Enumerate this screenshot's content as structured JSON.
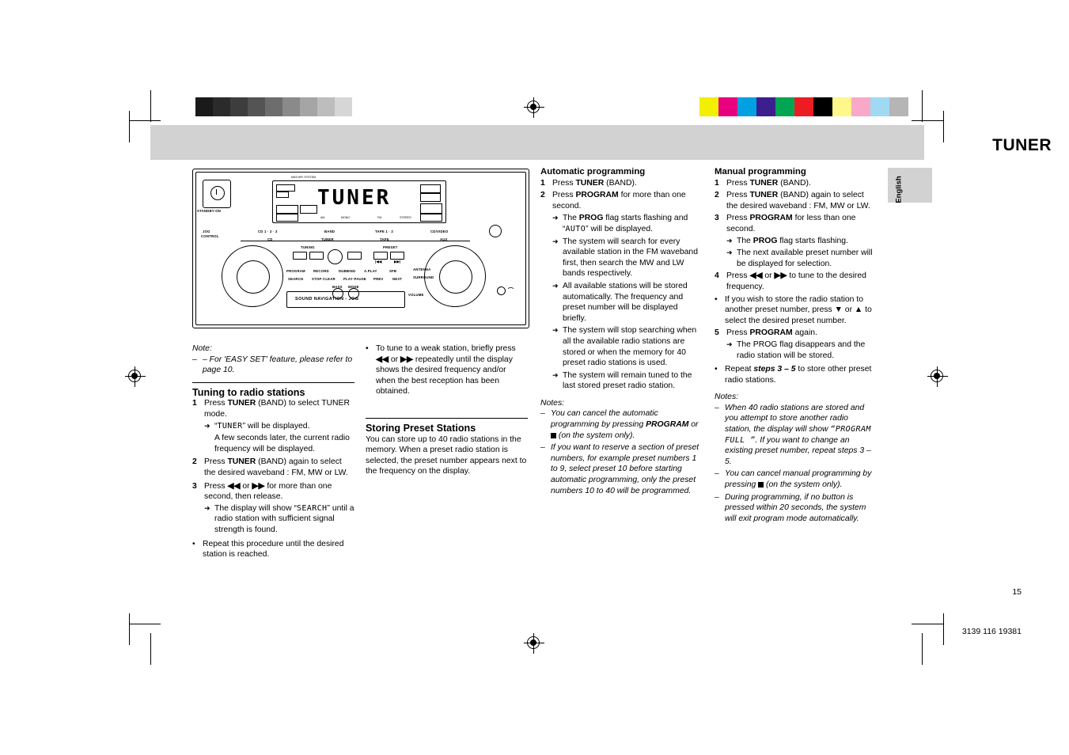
{
  "header": {
    "title": "TUNER",
    "side_tab": "English"
  },
  "device": {
    "brand": "MINI HIFI SYSTEM",
    "display_text": "TUNER",
    "standby_label": "STANDBY-ON",
    "jog_label": "JOG",
    "jog_label2": "CONTROL",
    "source_labels": [
      "CD 1 · 2 · 3",
      "BAND",
      "TAPE 1 · 2",
      "CD/VIDEO"
    ],
    "source_labels2": [
      "CD",
      "TUNER",
      "TAPE",
      "AUX"
    ],
    "tuning_label": "TUNING",
    "preset_label": "PRESET",
    "button_row": [
      "PROGRAM",
      "RECORD",
      "DUBBING",
      "A.PLAY",
      "SFB",
      "ANTENNA"
    ],
    "button_row2": [
      "SEARCH",
      "STOP-CLEAR",
      "PLAY-PAUSE",
      "PREV",
      "NEXT"
    ],
    "nav_label": "SOUND NAVIGATION - JOG",
    "volume_label": "VOLUME",
    "headphone_label": "p"
  },
  "col1": {
    "note_title": "Note:",
    "note_items": [
      "– For 'EASY SET' feature, please refer to page 10."
    ],
    "heading": "Tuning to radio stations",
    "steps": [
      {
        "n": "1",
        "text_pre": "Press ",
        "bold": "TUNER",
        "text_post": " (BAND) to select TUNER mode.",
        "subs": [
          {
            "mark": "→",
            "parts": [
              {
                "t": "“"
              },
              {
                "t": "TUNER",
                "lcd": true
              },
              {
                "t": "” will be displayed."
              }
            ]
          },
          {
            "mark": "",
            "parts": [
              {
                "t": "A few seconds later, the current radio frequency will be displayed."
              }
            ]
          }
        ]
      },
      {
        "n": "2",
        "text_pre": "Press ",
        "bold": "TUNER",
        "text_post": " (BAND) again to select the desired waveband : FM, MW or LW.",
        "subs": []
      },
      {
        "n": "3",
        "text_pre": "Press ◂◂ or ▸▸ for more than one second, then release.",
        "bold": "",
        "text_post": "",
        "subs": [
          {
            "mark": "→",
            "parts": [
              {
                "t": "The display will show "
              },
              {
                "t": "“SEARCH”",
                "lcd": true
              },
              {
                "t": " until a radio station with sufficient signal strength is found."
              }
            ]
          }
        ]
      }
    ],
    "bullets": [
      "Repeat this procedure until the desired station is reached."
    ]
  },
  "col2": {
    "bullets_top": [
      "To tune to a weak station, briefly press ◂◂ or ▸▸ repeatedly until the display shows the desired frequency and/or when the best reception has been obtained."
    ],
    "heading": "Storing Preset Stations",
    "body": "You can store up to 40 radio stations in the memory. When a preset radio station is selected, the preset number appears next to the frequency on the display."
  },
  "col3": {
    "heading": "Automatic programming",
    "steps": [
      {
        "n": "1",
        "text_pre": "Press ",
        "bold": "TUNER",
        "text_post": " (BAND).",
        "subs": []
      },
      {
        "n": "2",
        "text_pre": "Press ",
        "bold": "PROGRAM",
        "text_post": " for more than one second.",
        "subs": [
          {
            "mark": "→",
            "parts": [
              {
                "t": "The "
              },
              {
                "t": "PROG",
                "bold": true
              },
              {
                "t": " flag starts flashing and "
              },
              {
                "t": "“AUTO”",
                "lcd": true
              },
              {
                "t": " will be displayed."
              }
            ]
          },
          {
            "mark": "→",
            "parts": [
              {
                "t": "The system will search for every available station in the FM waveband first, then search the MW and LW bands respectively."
              }
            ]
          },
          {
            "mark": "→",
            "parts": [
              {
                "t": "All available stations will be stored automatically. The frequency and preset number will be displayed briefly."
              }
            ]
          },
          {
            "mark": "→",
            "parts": [
              {
                "t": "The system  will stop searching when all the available radio stations are stored or when the memory for 40 preset radio stations is used."
              }
            ]
          },
          {
            "mark": "→",
            "parts": [
              {
                "t": "The system will remain tuned to the last stored preset radio station."
              }
            ]
          }
        ]
      }
    ],
    "notes_title": "Notes:",
    "notes": [
      {
        "parts": [
          {
            "t": "You can cancel the automatic programming by pressing "
          },
          {
            "t": "PROGRAM",
            "italic_bold": true
          },
          {
            "t": " or "
          },
          {
            "square": true
          },
          {
            "t": " (on the system only)."
          }
        ]
      },
      {
        "parts": [
          {
            "t": "If you want to reserve a section of preset numbers, for example preset numbers 1 to 9, select preset 10 before starting automatic programming, only the preset numbers 10 to 40 will be programmed."
          }
        ]
      }
    ]
  },
  "col4": {
    "heading": "Manual programming",
    "steps": [
      {
        "n": "1",
        "text_pre": "Press ",
        "bold": "TUNER",
        "text_post": " (BAND).",
        "subs": []
      },
      {
        "n": "2",
        "text_pre": "Press ",
        "bold": "TUNER",
        "text_post": " (BAND) again to select the desired waveband : FM, MW or LW.",
        "subs": []
      },
      {
        "n": "3",
        "text_pre": "Press ",
        "bold": "PROGRAM",
        "text_post": " for less than one second.",
        "subs": [
          {
            "mark": "→",
            "parts": [
              {
                "t": "The "
              },
              {
                "t": "PROG",
                "bold": true
              },
              {
                "t": " flag starts flashing."
              }
            ]
          },
          {
            "mark": "→",
            "parts": [
              {
                "t": "The next available preset number will be displayed for selection."
              }
            ]
          }
        ]
      },
      {
        "n": "4",
        "text_pre": "Press ◂◂ or ▸▸ to tune to the desired frequency.",
        "bold": "",
        "text_post": "",
        "subs": []
      }
    ],
    "bullet_mid": "If you wish to store the radio station to another preset number, press ▼ or ▲ to select the desired preset number.",
    "step5": {
      "n": "5",
      "text_pre": "Press ",
      "bold": "PROGRAM",
      "text_post": " again.",
      "subs": [
        {
          "mark": "→",
          "parts": [
            {
              "t": "The PROG flag disappears and the radio station will be stored."
            }
          ]
        }
      ]
    },
    "bullet_repeat": {
      "parts": [
        {
          "t": "Repeat "
        },
        {
          "t": "steps 3 – 5",
          "italic_bold": true
        },
        {
          "t": " to store other preset radio stations."
        }
      ]
    },
    "notes_title": "Notes:",
    "notes": [
      {
        "parts": [
          {
            "t": "When 40 radio stations are stored and you attempt to store another radio station, the display will show "
          },
          {
            "t": "“PROGRAM FULL ”",
            "lcd": true
          },
          {
            "t": ".  If you want to change an existing preset number, repeat steps 3 – 5."
          }
        ]
      },
      {
        "parts": [
          {
            "t": "You can cancel manual programming by pressing "
          },
          {
            "square": true
          },
          {
            "t": " (on the system only)."
          }
        ]
      },
      {
        "parts": [
          {
            "t": "During programming,  if no button is pressed within 20 seconds, the system will exit program mode automatically."
          }
        ]
      }
    ]
  },
  "footer": {
    "page_number": "15",
    "doc_number": "3139 116 19381"
  },
  "colorbars": {
    "left": [
      "#ffffff",
      "#1a1a1a",
      "#2b2b2b",
      "#3d3d3d",
      "#545454",
      "#6d6d6d",
      "#8a8a8a",
      "#a5a5a5",
      "#bdbdbd",
      "#d6d6d6",
      "#ffffff"
    ],
    "right": [
      "#f2ef00",
      "#e8007f",
      "#00a0e2",
      "#3b1f8f",
      "#00a651",
      "#ed1c24",
      "#000000",
      "#fff78a",
      "#f9a8c8",
      "#9fd9f2",
      "#b5b5b5"
    ]
  }
}
